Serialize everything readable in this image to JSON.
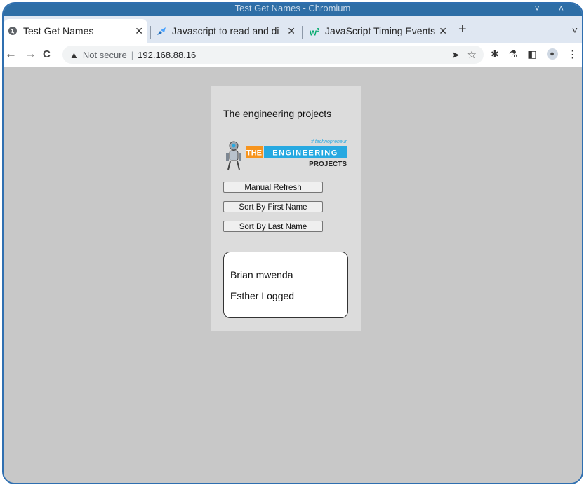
{
  "window": {
    "title": "Test Get Names - Chromium",
    "controls": "˅ ˄"
  },
  "tabs": [
    {
      "label": "Test Get Names",
      "icon": "globe-icon",
      "active": true
    },
    {
      "label": "Javascript to read and di",
      "icon": "stack-icon",
      "active": false
    },
    {
      "label": "JavaScript Timing Events",
      "icon": "w3-icon",
      "active": false
    }
  ],
  "toolbar": {
    "back": "←",
    "forward": "→",
    "reload": "C",
    "security_label": "Not secure",
    "url": "192.168.88.16",
    "new_tab": "+",
    "tab_menu": "˅"
  },
  "page": {
    "title": "The engineering projects",
    "logo": {
      "tag": "# technopreneur",
      "word1": "THE",
      "word2": "ENGINEERING",
      "word3": "PROJECTS",
      "colors": {
        "orange": "#f7941d",
        "blue": "#27a9e1",
        "dark": "#222222"
      }
    },
    "buttons": {
      "refresh": "Manual Refresh",
      "sort_first": "Sort By First Name",
      "sort_last": "Sort By Last Name"
    },
    "names": [
      "Brian mwenda",
      "Esther Logged"
    ]
  },
  "colors": {
    "frame": "#2f6fb0",
    "tabstrip": "#dfe7f2",
    "page_bg": "#c8c8c8",
    "card_bg": "#dcdcdc"
  }
}
